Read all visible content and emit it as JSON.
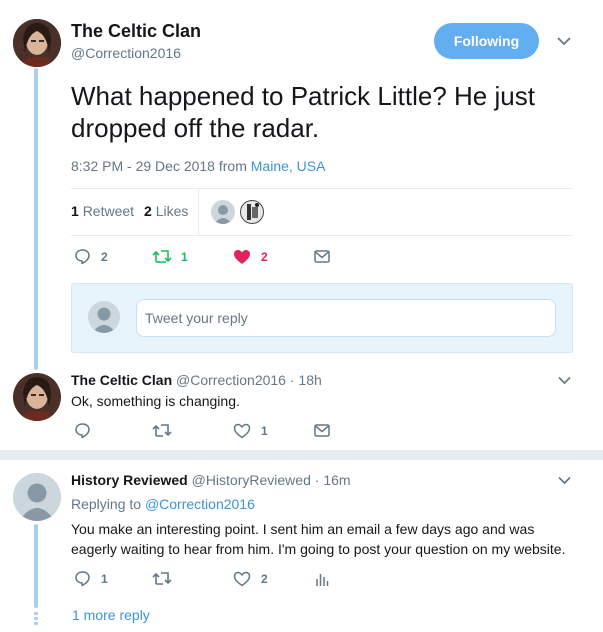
{
  "main_tweet": {
    "author_name": "The Celtic Clan",
    "author_handle": "@Correction2016",
    "follow_button": "Following",
    "text": "What happened to Patrick Little?  He just dropped off the radar.",
    "timestamp": "8:32 PM - 29 Dec 2018",
    "from_label": "from",
    "location": "Maine, USA",
    "retweets_count": "1",
    "retweets_label": "Retweet",
    "likes_count": "2",
    "likes_label": "Likes",
    "actions": {
      "reply_count": "2",
      "retweet_count": "1",
      "like_count": "2"
    }
  },
  "reply_box": {
    "placeholder": "Tweet your reply"
  },
  "reply1": {
    "author_name": "The Celtic Clan",
    "author_handle": "@Correction2016",
    "separator": "·",
    "time": "18h",
    "text": "Ok, something is changing.",
    "like_count": "1"
  },
  "reply2": {
    "author_name": "History Reviewed",
    "author_handle": "@HistoryReviewed",
    "separator": "·",
    "time": "16m",
    "replying_prefix": "Replying to",
    "replying_to": "@Correction2016",
    "text": "You make an interesting point. I sent him an email a few days ago and was eagerly waiting to hear from him. I'm going to post your question on my website.",
    "reply_count": "1",
    "like_count": "2"
  },
  "more_replies": "1 more reply",
  "colors": {
    "accent": "#3b94d9",
    "retweet_active": "#17bf63",
    "like_active": "#e0245e",
    "thread_line": "#a7d0ef"
  }
}
